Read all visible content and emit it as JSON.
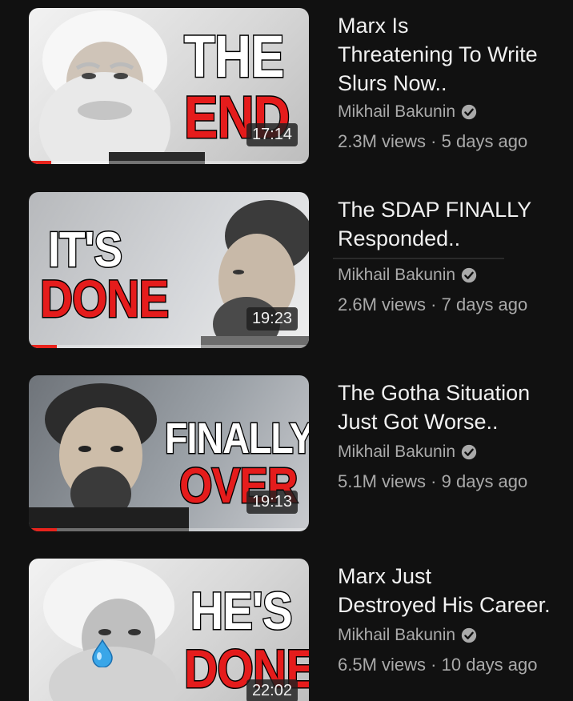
{
  "feed": {
    "videos": [
      {
        "title_lines": [
          "Marx Is",
          "Threatening To Write",
          "Slurs Now.."
        ],
        "channel": "Mikhail Bakunin",
        "views": "2.3M views",
        "age": "5 days ago",
        "separator": "·",
        "duration": "17:14",
        "overlay_lines": [
          "THE",
          "END"
        ],
        "watched_progress": 0.08
      },
      {
        "title_lines": [
          "The SDAP FINALLY",
          "Responded.."
        ],
        "channel": "Mikhail Bakunin",
        "views": "2.6M views",
        "age": "7 days ago",
        "separator": "·",
        "duration": "19:23",
        "overlay_lines": [
          "IT'S",
          "DONE"
        ],
        "watched_progress": 0.1
      },
      {
        "title_lines": [
          "The Gotha Situation",
          "Just Got Worse.."
        ],
        "channel": "Mikhail Bakunin",
        "views": "5.1M views",
        "age": "9 days ago",
        "separator": "·",
        "duration": "19:13",
        "overlay_lines": [
          "FINALLY",
          "OVER"
        ],
        "watched_progress": 0.1
      },
      {
        "title_lines": [
          "Marx Just",
          "Destroyed His Career."
        ],
        "channel": "Mikhail Bakunin",
        "views": "6.5M views",
        "age": "10 days ago",
        "separator": "·",
        "duration": "22:02",
        "overlay_lines": [
          "HE'S",
          "DONE"
        ],
        "watched_progress": 0
      }
    ]
  },
  "icons": {
    "verified": "verified-check-icon",
    "tear": "teardrop-icon"
  },
  "colors": {
    "background": "#111111",
    "title_text": "#f1f1f1",
    "secondary_text": "#aaaaaa",
    "overlay_red": "#e51c1c",
    "progress_red": "#e8231c"
  }
}
